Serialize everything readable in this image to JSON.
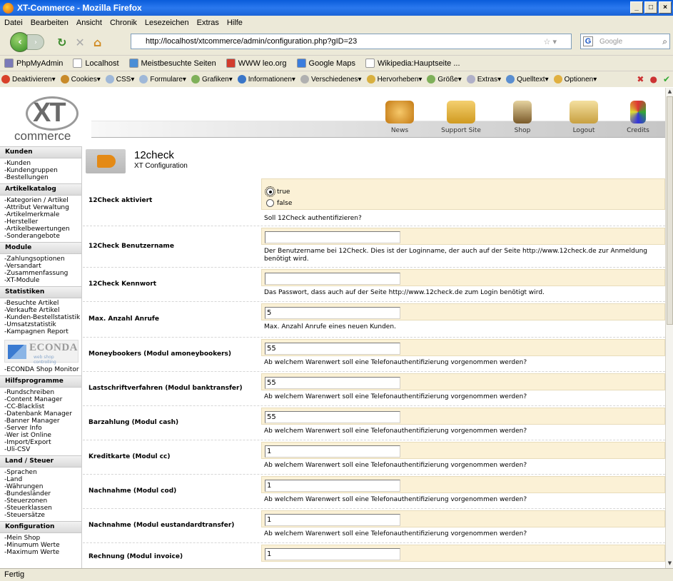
{
  "window": {
    "title": "XT-Commerce - Mozilla Firefox"
  },
  "menubar": [
    "Datei",
    "Bearbeiten",
    "Ansicht",
    "Chronik",
    "Lesezeichen",
    "Extras",
    "Hilfe"
  ],
  "navbar": {
    "url": "http://localhost/xtcommerce/admin/configuration.php?gID=23",
    "search_placeholder": "Google",
    "search_engine_glyph": "G"
  },
  "bookmarks": [
    {
      "label": "PhpMyAdmin",
      "color": "#7a7ab8"
    },
    {
      "label": "Localhost",
      "color": "#ffffff"
    },
    {
      "label": "Meistbesuchte Seiten",
      "color": "#4a8ed6"
    },
    {
      "label": "WWW leo.org",
      "color": "#d23c2c"
    },
    {
      "label": "Google Maps",
      "color": "#3b7ddd"
    },
    {
      "label": "Wikipedia:Hauptseite ...",
      "color": "#ffffff"
    }
  ],
  "devbar": [
    {
      "label": "Deaktivieren▾",
      "color": "#d8402a"
    },
    {
      "label": "Cookies▾",
      "color": "#c88a2a"
    },
    {
      "label": "CSS▾",
      "color": "#9fb8d8"
    },
    {
      "label": "Formulare▾",
      "color": "#9fb8d8"
    },
    {
      "label": "Grafiken▾",
      "color": "#7fb05a"
    },
    {
      "label": "Informationen▾",
      "color": "#3a76c8"
    },
    {
      "label": "Verschiedenes▾",
      "color": "#b0b0b0"
    },
    {
      "label": "Hervorheben▾",
      "color": "#d8b040"
    },
    {
      "label": "Größe▾",
      "color": "#7fb05a"
    },
    {
      "label": "Extras▾",
      "color": "#b0b0c8"
    },
    {
      "label": "Quelltext▾",
      "color": "#5a8ed0"
    },
    {
      "label": "Optionen▾",
      "color": "#e0b040"
    }
  ],
  "header": {
    "logo_text": "XT",
    "logo_word": "commerce",
    "links": [
      "News",
      "Support Site",
      "Shop",
      "Logout",
      "Credits"
    ]
  },
  "sidebar": [
    {
      "heading": "Kunden",
      "items": [
        "-Kunden",
        "-Kundengruppen",
        "-Bestellungen"
      ]
    },
    {
      "heading": "Artikelkatalog",
      "items": [
        "-Kategorien / Artikel",
        "-Attribut Verwaltung",
        "-Artikelmerkmale",
        "-Hersteller",
        "-Artikelbewertungen",
        "-Sonderangebote"
      ]
    },
    {
      "heading": "Module",
      "items": [
        "-Zahlungsoptionen",
        "-Versandart",
        "-Zusammenfassung",
        "-XT-Module"
      ]
    },
    {
      "heading": "Statistiken",
      "items": [
        "-Besuchte Artikel",
        "-Verkaufte Artikel",
        "-Kunden-Bestellstatistik",
        "-Umsatzstatistik",
        "-Kampagnen Report"
      ]
    },
    {
      "heading": "",
      "items": [
        "-ECONDA Shop Monitor"
      ]
    },
    {
      "heading": "Hilfsprogramme",
      "items": [
        "-Rundschreiben",
        "-Content Manager",
        "-CC-Blacklist",
        "-Datenbank Manager",
        "-Banner Manager",
        "-Server Info",
        "-Wer ist Online",
        "-Import/Export",
        "-Uli-CSV"
      ]
    },
    {
      "heading": "Land / Steuer",
      "items": [
        "-Sprachen",
        "-Land",
        "-Währungen",
        "-Bundesländer",
        "-Steuerzonen",
        "-Steuerklassen",
        "-Steuersätze"
      ]
    },
    {
      "heading": "Konfiguration",
      "items": [
        "-Mein Shop",
        "-Minumum Werte",
        "-Maximum Werte"
      ]
    }
  ],
  "econda": {
    "name": "ECONDA",
    "tagline": "web shop controlling"
  },
  "config": {
    "title": "12check",
    "subtitle": "XT Configuration",
    "rows": [
      {
        "label": "12Check aktiviert",
        "type": "radio",
        "options": [
          "true",
          "false"
        ],
        "selected": "true",
        "desc": "Soll 12Check authentifizieren?"
      },
      {
        "label": "12Check Benutzername",
        "type": "text",
        "value": "",
        "desc": "Der Benutzername bei 12Check. Dies ist der Loginname, der auch auf der Seite http://www.12check.de zur Anmeldung benötigt wird."
      },
      {
        "label": "12Check Kennwort",
        "type": "text",
        "value": "",
        "desc": "Das Passwort, dass auch auf der Seite http://www.12check.de zum Login benötigt wird."
      },
      {
        "label": "Max. Anzahl Anrufe",
        "type": "text",
        "value": "5",
        "desc": "Max. Anzahl Anrufe eines neuen Kunden."
      },
      {
        "label": "Moneybookers (Modul amoneybookers)",
        "type": "text",
        "value": "55",
        "desc": "Ab welchem Warenwert soll eine Telefonauthentifizierung vorgenommen werden?"
      },
      {
        "label": "Lastschriftverfahren (Modul banktransfer)",
        "type": "text",
        "value": "55",
        "desc": "Ab welchem Warenwert soll eine Telefonauthentifizierung vorgenommen werden?"
      },
      {
        "label": "Barzahlung (Modul cash)",
        "type": "text",
        "value": "55",
        "desc": "Ab welchem Warenwert soll eine Telefonauthentifizierung vorgenommen werden?"
      },
      {
        "label": "Kreditkarte (Modul cc)",
        "type": "text",
        "value": "1",
        "desc": "Ab welchem Warenwert soll eine Telefonauthentifizierung vorgenommen werden?"
      },
      {
        "label": "Nachnahme (Modul cod)",
        "type": "text",
        "value": "1",
        "desc": "Ab welchem Warenwert soll eine Telefonauthentifizierung vorgenommen werden?"
      },
      {
        "label": "Nachnahme (Modul eustandardtransfer)",
        "type": "text",
        "value": "1",
        "desc": "Ab welchem Warenwert soll eine Telefonauthentifizierung vorgenommen werden?"
      },
      {
        "label": "Rechnung (Modul invoice)",
        "type": "text",
        "value": "1",
        "desc": ""
      }
    ]
  },
  "status": {
    "text": "Fertig"
  }
}
